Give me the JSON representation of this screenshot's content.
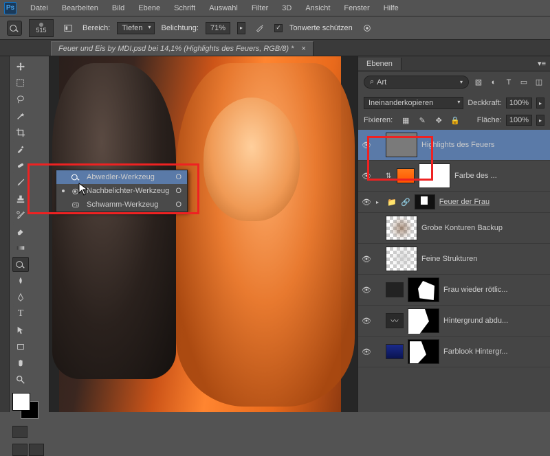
{
  "menubar": {
    "items": [
      "Datei",
      "Bearbeiten",
      "Bild",
      "Ebene",
      "Schrift",
      "Auswahl",
      "Filter",
      "3D",
      "Ansicht",
      "Fenster",
      "Hilfe"
    ]
  },
  "optionsbar": {
    "brush_size": "515",
    "range_label": "Bereich:",
    "range_value": "Tiefen",
    "exposure_label": "Belichtung:",
    "exposure_value": "71%",
    "protect_tones": "Tonwerte schützen",
    "protect_checked": "✓"
  },
  "document": {
    "tab_title": "Feuer und Eis by MDI.psd bei 14,1% (Highlights des Feuers, RGB/8) *"
  },
  "tool_flyout": {
    "items": [
      {
        "label": "Abwedler-Werkzeug",
        "shortcut": "O",
        "active": false,
        "highlighted": true
      },
      {
        "label": "Nachbelichter-Werkzeug",
        "shortcut": "O",
        "active": true,
        "highlighted": false
      },
      {
        "label": "Schwamm-Werkzeug",
        "shortcut": "O",
        "active": false,
        "highlighted": false
      }
    ]
  },
  "panels": {
    "layers_tab": "Ebenen",
    "search_label": "Art",
    "blend_mode": "Ineinanderkopieren",
    "opacity_label": "Deckkraft:",
    "opacity_value": "100%",
    "lock_label": "Fixieren:",
    "fill_label": "Fläche:",
    "fill_value": "100%"
  },
  "layers": [
    {
      "name": "Highlights des Feuers",
      "visible": true,
      "selected": true,
      "thumb": "gray"
    },
    {
      "name": "Farbe des ...",
      "visible": true,
      "adjustment": "orange",
      "mask": "white"
    },
    {
      "name": "Feuer der Frau",
      "visible": true,
      "group": true,
      "underline": true
    },
    {
      "name": "Grobe Konturen Backup",
      "visible": false,
      "thumb": "checker-fine"
    },
    {
      "name": "Feine Strukturen",
      "visible": true,
      "thumb": "checker-fine2"
    },
    {
      "name": "Frau wieder rötlic...",
      "visible": true,
      "adjustment": "dark",
      "mask": "shape1"
    },
    {
      "name": "Hintergrund abdu...",
      "visible": true,
      "adjustment": "curves",
      "mask": "shape2"
    },
    {
      "name": "Farblook Hintergr...",
      "visible": true,
      "adjustment": "blue",
      "mask": "shape3"
    }
  ]
}
